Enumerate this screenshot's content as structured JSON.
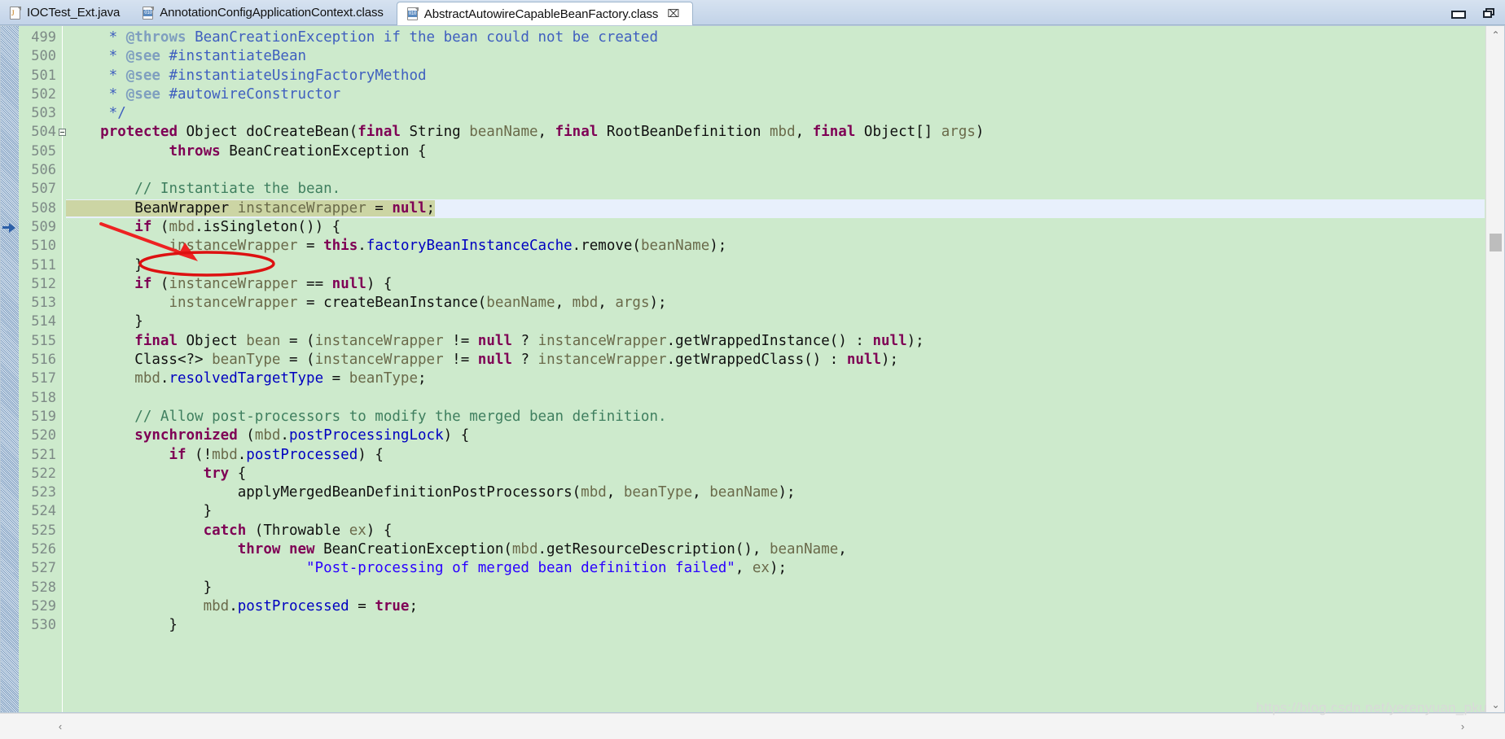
{
  "window": {
    "minimize_label": "–",
    "maximize_label": "❐"
  },
  "tabs": [
    {
      "label": "IOCTest_Ext.java",
      "icon": "java-file-icon",
      "active": false,
      "closable": false
    },
    {
      "label": "AnnotationConfigApplicationContext.class",
      "icon": "class-file-icon",
      "active": false,
      "closable": false
    },
    {
      "label": "AbstractAutowireCapableBeanFactory.class",
      "icon": "class-file-icon",
      "active": true,
      "closable": true,
      "close_label": "⌧"
    }
  ],
  "editor": {
    "first_line": 499,
    "current_line": 508,
    "scroll": {
      "up_arrow": "⌃",
      "down_arrow": "⌄",
      "left_arrow": "‹",
      "right_arrow": "›"
    },
    "annotation": {
      "type": "red-arrow-and-ellipse",
      "color": "#ee2222",
      "target_token": "BeanWrapper"
    },
    "lines": [
      {
        "n": 499,
        "tokens": [
          {
            "t": "     * ",
            "c": "jdoc"
          },
          {
            "t": "@throws",
            "c": "jtag"
          },
          {
            "t": " BeanCreationException if the bean could not be created",
            "c": "jdoc"
          }
        ]
      },
      {
        "n": 500,
        "tokens": [
          {
            "t": "     * ",
            "c": "jdoc"
          },
          {
            "t": "@see",
            "c": "jtag"
          },
          {
            "t": " #instantiateBean",
            "c": "jdoc"
          }
        ]
      },
      {
        "n": 501,
        "tokens": [
          {
            "t": "     * ",
            "c": "jdoc"
          },
          {
            "t": "@see",
            "c": "jtag"
          },
          {
            "t": " #instantiateUsingFactoryMethod",
            "c": "jdoc"
          }
        ]
      },
      {
        "n": 502,
        "tokens": [
          {
            "t": "     * ",
            "c": "jdoc"
          },
          {
            "t": "@see",
            "c": "jtag"
          },
          {
            "t": " #autowireConstructor",
            "c": "jdoc"
          }
        ]
      },
      {
        "n": 503,
        "tokens": [
          {
            "t": "     */",
            "c": "jdoc"
          }
        ]
      },
      {
        "n": 504,
        "fold": true,
        "tokens": [
          {
            "t": "    ",
            "c": "plain"
          },
          {
            "t": "protected",
            "c": "kw"
          },
          {
            "t": " Object doCreateBean(",
            "c": "plain"
          },
          {
            "t": "final",
            "c": "kw"
          },
          {
            "t": " String ",
            "c": "plain"
          },
          {
            "t": "beanName",
            "c": "par"
          },
          {
            "t": ", ",
            "c": "plain"
          },
          {
            "t": "final",
            "c": "kw"
          },
          {
            "t": " RootBeanDefinition ",
            "c": "plain"
          },
          {
            "t": "mbd",
            "c": "par"
          },
          {
            "t": ", ",
            "c": "plain"
          },
          {
            "t": "final",
            "c": "kw"
          },
          {
            "t": " Object[] ",
            "c": "plain"
          },
          {
            "t": "args",
            "c": "par"
          },
          {
            "t": ")",
            "c": "plain"
          }
        ]
      },
      {
        "n": 505,
        "tokens": [
          {
            "t": "            ",
            "c": "plain"
          },
          {
            "t": "throws",
            "c": "kw"
          },
          {
            "t": " BeanCreationException {",
            "c": "plain"
          }
        ]
      },
      {
        "n": 506,
        "tokens": []
      },
      {
        "n": 507,
        "tokens": [
          {
            "t": "        ",
            "c": "plain"
          },
          {
            "t": "// Instantiate the bean.",
            "c": "cmt"
          }
        ]
      },
      {
        "n": 508,
        "current": true,
        "selection_end": 36,
        "tokens": [
          {
            "t": "        BeanWrapper ",
            "c": "plain"
          },
          {
            "t": "instanceWrapper",
            "c": "par"
          },
          {
            "t": " = ",
            "c": "plain"
          },
          {
            "t": "null",
            "c": "kw"
          },
          {
            "t": ";",
            "c": "plain"
          }
        ]
      },
      {
        "n": 509,
        "tokens": [
          {
            "t": "        ",
            "c": "plain"
          },
          {
            "t": "if",
            "c": "kw"
          },
          {
            "t": " (",
            "c": "plain"
          },
          {
            "t": "mbd",
            "c": "par"
          },
          {
            "t": ".isSingleton()) {",
            "c": "plain"
          }
        ]
      },
      {
        "n": 510,
        "tokens": [
          {
            "t": "            ",
            "c": "plain"
          },
          {
            "t": "instanceWrapper",
            "c": "par"
          },
          {
            "t": " = ",
            "c": "plain"
          },
          {
            "t": "this",
            "c": "kw"
          },
          {
            "t": ".",
            "c": "plain"
          },
          {
            "t": "factoryBeanInstanceCache",
            "c": "fld"
          },
          {
            "t": ".remove(",
            "c": "plain"
          },
          {
            "t": "beanName",
            "c": "par"
          },
          {
            "t": ");",
            "c": "plain"
          }
        ]
      },
      {
        "n": 511,
        "tokens": [
          {
            "t": "        }",
            "c": "plain"
          }
        ]
      },
      {
        "n": 512,
        "tokens": [
          {
            "t": "        ",
            "c": "plain"
          },
          {
            "t": "if",
            "c": "kw"
          },
          {
            "t": " (",
            "c": "plain"
          },
          {
            "t": "instanceWrapper",
            "c": "par"
          },
          {
            "t": " == ",
            "c": "plain"
          },
          {
            "t": "null",
            "c": "kw"
          },
          {
            "t": ") {",
            "c": "plain"
          }
        ]
      },
      {
        "n": 513,
        "tokens": [
          {
            "t": "            ",
            "c": "plain"
          },
          {
            "t": "instanceWrapper",
            "c": "par"
          },
          {
            "t": " = createBeanInstance(",
            "c": "plain"
          },
          {
            "t": "beanName",
            "c": "par"
          },
          {
            "t": ", ",
            "c": "plain"
          },
          {
            "t": "mbd",
            "c": "par"
          },
          {
            "t": ", ",
            "c": "plain"
          },
          {
            "t": "args",
            "c": "par"
          },
          {
            "t": ");",
            "c": "plain"
          }
        ]
      },
      {
        "n": 514,
        "tokens": [
          {
            "t": "        }",
            "c": "plain"
          }
        ]
      },
      {
        "n": 515,
        "tokens": [
          {
            "t": "        ",
            "c": "plain"
          },
          {
            "t": "final",
            "c": "kw"
          },
          {
            "t": " Object ",
            "c": "plain"
          },
          {
            "t": "bean",
            "c": "par"
          },
          {
            "t": " = (",
            "c": "plain"
          },
          {
            "t": "instanceWrapper",
            "c": "par"
          },
          {
            "t": " != ",
            "c": "plain"
          },
          {
            "t": "null",
            "c": "kw"
          },
          {
            "t": " ? ",
            "c": "plain"
          },
          {
            "t": "instanceWrapper",
            "c": "par"
          },
          {
            "t": ".getWrappedInstance() : ",
            "c": "plain"
          },
          {
            "t": "null",
            "c": "kw"
          },
          {
            "t": ");",
            "c": "plain"
          }
        ]
      },
      {
        "n": 516,
        "tokens": [
          {
            "t": "        Class<?> ",
            "c": "plain"
          },
          {
            "t": "beanType",
            "c": "par"
          },
          {
            "t": " = (",
            "c": "plain"
          },
          {
            "t": "instanceWrapper",
            "c": "par"
          },
          {
            "t": " != ",
            "c": "plain"
          },
          {
            "t": "null",
            "c": "kw"
          },
          {
            "t": " ? ",
            "c": "plain"
          },
          {
            "t": "instanceWrapper",
            "c": "par"
          },
          {
            "t": ".getWrappedClass() : ",
            "c": "plain"
          },
          {
            "t": "null",
            "c": "kw"
          },
          {
            "t": ");",
            "c": "plain"
          }
        ]
      },
      {
        "n": 517,
        "tokens": [
          {
            "t": "        ",
            "c": "plain"
          },
          {
            "t": "mbd",
            "c": "par"
          },
          {
            "t": ".",
            "c": "plain"
          },
          {
            "t": "resolvedTargetType",
            "c": "fld"
          },
          {
            "t": " = ",
            "c": "plain"
          },
          {
            "t": "beanType",
            "c": "par"
          },
          {
            "t": ";",
            "c": "plain"
          }
        ]
      },
      {
        "n": 518,
        "tokens": []
      },
      {
        "n": 519,
        "tokens": [
          {
            "t": "        ",
            "c": "plain"
          },
          {
            "t": "// Allow post-processors to modify the merged bean definition.",
            "c": "cmt"
          }
        ]
      },
      {
        "n": 520,
        "tokens": [
          {
            "t": "        ",
            "c": "plain"
          },
          {
            "t": "synchronized",
            "c": "kw"
          },
          {
            "t": " (",
            "c": "plain"
          },
          {
            "t": "mbd",
            "c": "par"
          },
          {
            "t": ".",
            "c": "plain"
          },
          {
            "t": "postProcessingLock",
            "c": "fld"
          },
          {
            "t": ") {",
            "c": "plain"
          }
        ]
      },
      {
        "n": 521,
        "tokens": [
          {
            "t": "            ",
            "c": "plain"
          },
          {
            "t": "if",
            "c": "kw"
          },
          {
            "t": " (!",
            "c": "plain"
          },
          {
            "t": "mbd",
            "c": "par"
          },
          {
            "t": ".",
            "c": "plain"
          },
          {
            "t": "postProcessed",
            "c": "fld"
          },
          {
            "t": ") {",
            "c": "plain"
          }
        ]
      },
      {
        "n": 522,
        "tokens": [
          {
            "t": "                ",
            "c": "plain"
          },
          {
            "t": "try",
            "c": "kw"
          },
          {
            "t": " {",
            "c": "plain"
          }
        ]
      },
      {
        "n": 523,
        "tokens": [
          {
            "t": "                    applyMergedBeanDefinitionPostProcessors(",
            "c": "plain"
          },
          {
            "t": "mbd",
            "c": "par"
          },
          {
            "t": ", ",
            "c": "plain"
          },
          {
            "t": "beanType",
            "c": "par"
          },
          {
            "t": ", ",
            "c": "plain"
          },
          {
            "t": "beanName",
            "c": "par"
          },
          {
            "t": ");",
            "c": "plain"
          }
        ]
      },
      {
        "n": 524,
        "tokens": [
          {
            "t": "                }",
            "c": "plain"
          }
        ]
      },
      {
        "n": 525,
        "tokens": [
          {
            "t": "                ",
            "c": "plain"
          },
          {
            "t": "catch",
            "c": "kw"
          },
          {
            "t": " (Throwable ",
            "c": "plain"
          },
          {
            "t": "ex",
            "c": "par"
          },
          {
            "t": ") {",
            "c": "plain"
          }
        ]
      },
      {
        "n": 526,
        "tokens": [
          {
            "t": "                    ",
            "c": "plain"
          },
          {
            "t": "throw",
            "c": "kw"
          },
          {
            "t": " ",
            "c": "plain"
          },
          {
            "t": "new",
            "c": "kw"
          },
          {
            "t": " BeanCreationException(",
            "c": "plain"
          },
          {
            "t": "mbd",
            "c": "par"
          },
          {
            "t": ".getResourceDescription(), ",
            "c": "plain"
          },
          {
            "t": "beanName",
            "c": "par"
          },
          {
            "t": ",",
            "c": "plain"
          }
        ]
      },
      {
        "n": 527,
        "tokens": [
          {
            "t": "                            ",
            "c": "plain"
          },
          {
            "t": "\"Post-processing of merged bean definition failed\"",
            "c": "str"
          },
          {
            "t": ", ",
            "c": "plain"
          },
          {
            "t": "ex",
            "c": "par"
          },
          {
            "t": ");",
            "c": "plain"
          }
        ]
      },
      {
        "n": 528,
        "tokens": [
          {
            "t": "                }",
            "c": "plain"
          }
        ]
      },
      {
        "n": 529,
        "tokens": [
          {
            "t": "                ",
            "c": "plain"
          },
          {
            "t": "mbd",
            "c": "par"
          },
          {
            "t": ".",
            "c": "plain"
          },
          {
            "t": "postProcessed",
            "c": "fld"
          },
          {
            "t": " = ",
            "c": "plain"
          },
          {
            "t": "true",
            "c": "kw"
          },
          {
            "t": ";",
            "c": "plain"
          }
        ]
      },
      {
        "n": 530,
        "tokens": [
          {
            "t": "            }",
            "c": "plain"
          }
        ]
      }
    ]
  },
  "watermark": "https://blog.csdn.net/yerenyuan_pku"
}
